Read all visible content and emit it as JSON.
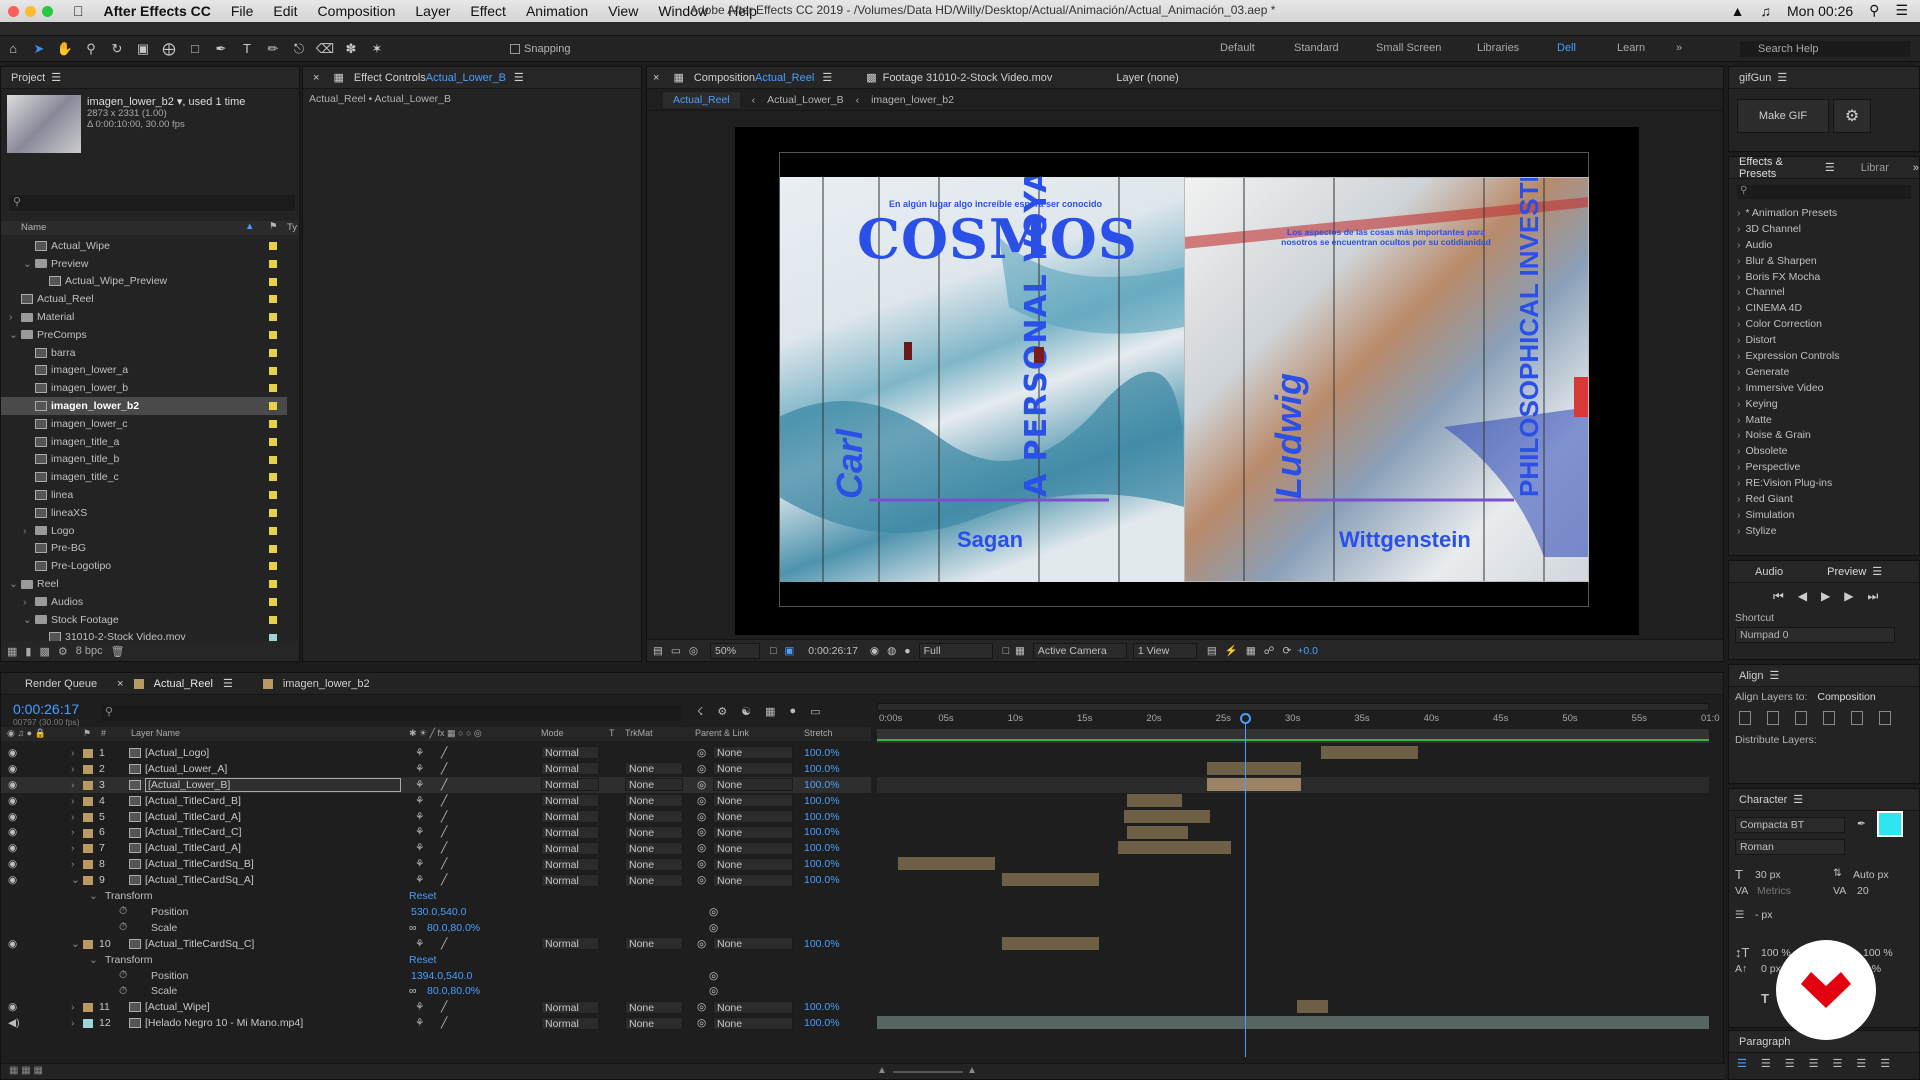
{
  "menubar": {
    "app": "After Effects CC",
    "items": [
      "File",
      "Edit",
      "Composition",
      "Layer",
      "Effect",
      "Animation",
      "View",
      "Window",
      "Help"
    ],
    "window_title": "Adobe After Effects CC 2019 - /Volumes/Data HD/Willy/Desktop/Actual/Animación/Actual_Animación_03.aep *",
    "clock": "Mon 00:26"
  },
  "toolbar": {
    "snapping": "Snapping",
    "workspaces": [
      "Default",
      "Standard",
      "Small Screen",
      "Libraries",
      "Dell",
      "Learn"
    ],
    "active_workspace": "Dell",
    "search_placeholder": "Search Help"
  },
  "project": {
    "title": "Project",
    "selected_name": "imagen_lower_b2",
    "selected_used": ", used 1 time",
    "selected_info1": "2873 x 2331 (1.00)",
    "selected_info2": "Δ 0:00:10:00, 30.00 fps",
    "col_name": "Name",
    "col_type": "Ty",
    "bpc": "8 bpc",
    "items": [
      {
        "name": "Actual_Wipe",
        "indent": 2,
        "kind": "comp"
      },
      {
        "name": "Preview",
        "indent": 2,
        "kind": "folder",
        "open": true
      },
      {
        "name": "Actual_Wipe_Preview",
        "indent": 3,
        "kind": "comp"
      },
      {
        "name": "Actual_Reel",
        "indent": 1,
        "kind": "comp"
      },
      {
        "name": "Material",
        "indent": 1,
        "kind": "folder"
      },
      {
        "name": "PreComps",
        "indent": 1,
        "kind": "folder",
        "open": true
      },
      {
        "name": "barra",
        "indent": 2,
        "kind": "comp"
      },
      {
        "name": "imagen_lower_a",
        "indent": 2,
        "kind": "comp"
      },
      {
        "name": "imagen_lower_b",
        "indent": 2,
        "kind": "comp"
      },
      {
        "name": "imagen_lower_b2",
        "indent": 2,
        "kind": "comp",
        "selected": true
      },
      {
        "name": "imagen_lower_c",
        "indent": 2,
        "kind": "comp"
      },
      {
        "name": "imagen_title_a",
        "indent": 2,
        "kind": "comp"
      },
      {
        "name": "imagen_title_b",
        "indent": 2,
        "kind": "comp"
      },
      {
        "name": "imagen_title_c",
        "indent": 2,
        "kind": "comp"
      },
      {
        "name": "linea",
        "indent": 2,
        "kind": "comp"
      },
      {
        "name": "lineaXS",
        "indent": 2,
        "kind": "comp"
      },
      {
        "name": "Logo",
        "indent": 2,
        "kind": "folder"
      },
      {
        "name": "Pre-BG",
        "indent": 2,
        "kind": "comp"
      },
      {
        "name": "Pre-Logotipo",
        "indent": 2,
        "kind": "comp"
      },
      {
        "name": "Reel",
        "indent": 1,
        "kind": "folder",
        "open": true
      },
      {
        "name": "Audios",
        "indent": 2,
        "kind": "folder"
      },
      {
        "name": "Stock Footage",
        "indent": 2,
        "kind": "folder",
        "open": true
      },
      {
        "name": "31010-2-Stock Video.mov",
        "indent": 3,
        "kind": "footage"
      }
    ]
  },
  "effect_controls": {
    "tab_prefix": "Effect Controls ",
    "tab_comp": "Actual_Lower_B",
    "breadcrumb": "Actual_Reel • Actual_Lower_B"
  },
  "comp_panel": {
    "tab_prefix": "Composition ",
    "tab_comp": "Actual_Reel",
    "footage_tab": "Footage 31010-2-Stock Video.mov",
    "layer_tab": "Layer (none)",
    "crumbs": [
      "Actual_Reel",
      "Actual_Lower_B",
      "imagen_lower_b2"
    ],
    "zoom": "50%",
    "timecode": "0:00:26:17",
    "resolution": "Full",
    "camera": "Active Camera",
    "views": "1 View",
    "exposure": "+0.0"
  },
  "frame_left": {
    "tagline": "En algún lugar algo increíble espera ser conocido",
    "title": "COSMOS",
    "vertical": "A PERSONAL VOYAGE",
    "first_name": "Carl",
    "last_name": "Sagan"
  },
  "frame_right": {
    "tagline": "Los aspectos de las cosas más importantes para nosotros se encuentran ocultos por su cotidianidad",
    "vertical": "PHILOSOPHICAL INVESTIGATIONS",
    "first_name": "Ludwig",
    "last_name": "Wittgenstein"
  },
  "gifgun": {
    "title": "gifGun",
    "button": "Make GIF"
  },
  "effects": {
    "tab": "Effects & Presets",
    "tab2": "Librar",
    "items": [
      "* Animation Presets",
      "3D Channel",
      "Audio",
      "Blur & Sharpen",
      "Boris FX Mocha",
      "Channel",
      "CINEMA 4D",
      "Color Correction",
      "Distort",
      "Expression Controls",
      "Generate",
      "Immersive Video",
      "Keying",
      "Matte",
      "Noise & Grain",
      "Obsolete",
      "Perspective",
      "RE:Vision Plug-ins",
      "Red Giant",
      "Simulation",
      "Stylize"
    ]
  },
  "preview": {
    "tab_audio": "Audio",
    "tab_preview": "Preview",
    "shortcut_label": "Shortcut",
    "shortcut_value": "Numpad 0"
  },
  "align": {
    "title": "Align",
    "align_to_label": "Align Layers to:",
    "align_to": "Composition",
    "distribute": "Distribute Layers:"
  },
  "character": {
    "title": "Character",
    "font": "Compacta BT",
    "style": "Roman",
    "size": "30 px",
    "leading": "Auto px",
    "kerning": "Metrics",
    "tracking": "20",
    "stroke": "- px",
    "vscale": "100 %",
    "hscale": "100 %",
    "baseline": "0 px",
    "tsume": "0 %",
    "fill_color": "#2ee6f0"
  },
  "paragraph": {
    "title": "Paragraph"
  },
  "timeline": {
    "tabs": [
      "Render Queue",
      "Actual_Reel",
      "imagen_lower_b2"
    ],
    "active_tab": "Actual_Reel",
    "timecode": "0:00:26:17",
    "frames": "00797 (30.00 fps)",
    "headers": {
      "layer_name": "Layer Name",
      "mode": "Mode",
      "t": "T",
      "trkmat": "TrkMat",
      "parent": "Parent & Link",
      "stretch": "Stretch"
    },
    "ruler": [
      "0:00s",
      "05s",
      "10s",
      "15s",
      "20s",
      "25s",
      "30s",
      "35s",
      "40s",
      "45s",
      "50s",
      "55s",
      "01:0"
    ],
    "playhead_sec": 26.57,
    "duration_sec": 60,
    "layers": [
      {
        "num": "1",
        "name": "[Actual_Logo]",
        "mode": "Normal",
        "trk": "",
        "parent": "None",
        "stretch": "100.0%",
        "start": 32,
        "end": 39,
        "selected": false
      },
      {
        "num": "2",
        "name": "[Actual_Lower_A]",
        "mode": "Normal",
        "trk": "None",
        "parent": "None",
        "stretch": "100.0%",
        "start": 23.8,
        "end": 30.6
      },
      {
        "num": "3",
        "name": "[Actual_Lower_B]",
        "mode": "Normal",
        "trk": "None",
        "parent": "None",
        "stretch": "100.0%",
        "start": 23.8,
        "end": 30.6,
        "selected": true
      },
      {
        "num": "4",
        "name": "[Actual_TitleCard_B]",
        "mode": "Normal",
        "trk": "None",
        "parent": "None",
        "stretch": "100.0%",
        "start": 18,
        "end": 22
      },
      {
        "num": "5",
        "name": "[Actual_TitleCard_A]",
        "mode": "Normal",
        "trk": "None",
        "parent": "None",
        "stretch": "100.0%",
        "start": 17.8,
        "end": 24
      },
      {
        "num": "6",
        "name": "[Actual_TitleCard_C]",
        "mode": "Normal",
        "trk": "None",
        "parent": "None",
        "stretch": "100.0%",
        "start": 18,
        "end": 22.4
      },
      {
        "num": "7",
        "name": "[Actual_TitleCard_A]",
        "mode": "Normal",
        "trk": "None",
        "parent": "None",
        "stretch": "100.0%",
        "start": 17.4,
        "end": 25.5
      },
      {
        "num": "8",
        "name": "[Actual_TitleCardSq_B]",
        "mode": "Normal",
        "trk": "None",
        "parent": "None",
        "stretch": "100.0%",
        "start": 1.5,
        "end": 8.5
      },
      {
        "num": "9",
        "name": "[Actual_TitleCardSq_A]",
        "mode": "Normal",
        "trk": "None",
        "parent": "None",
        "stretch": "100.0%",
        "start": 9,
        "end": 16,
        "open": true,
        "position": "530.0,540.0",
        "scale": "80.0,80.0%"
      },
      {
        "num": "10",
        "name": "[Actual_TitleCardSq_C]",
        "mode": "Normal",
        "trk": "None",
        "parent": "None",
        "stretch": "100.0%",
        "start": 9,
        "end": 16,
        "open": true,
        "position": "1394.0,540.0",
        "scale": "80.0,80.0%"
      },
      {
        "num": "11",
        "name": "[Actual_Wipe]",
        "mode": "Normal",
        "trk": "None",
        "parent": "None",
        "stretch": "100.0%",
        "start": 30.3,
        "end": 32.5
      },
      {
        "num": "12",
        "name": "[Helado Negro 10 - Mi Mano.mp4]",
        "mode": "Normal",
        "trk": "None",
        "parent": "None",
        "stretch": "100.0%",
        "start": 0,
        "end": 60,
        "audio": true
      }
    ],
    "transform_label": "Transform",
    "reset_label": "Reset",
    "position_label": "Position",
    "scale_label": "Scale"
  }
}
